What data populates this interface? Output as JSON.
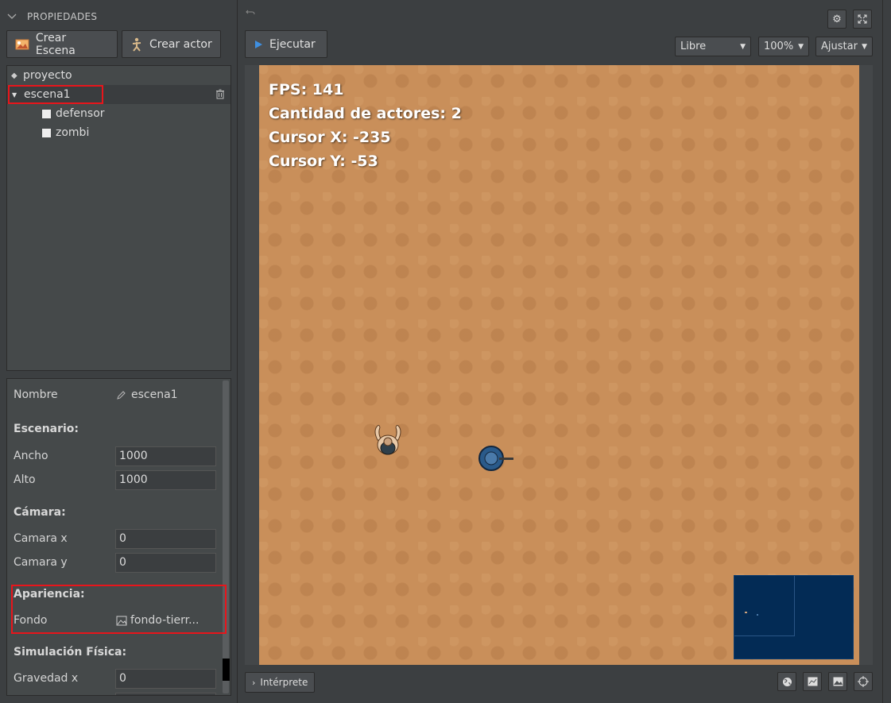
{
  "panel": {
    "title": "PROPIEDADES"
  },
  "toolbar": {
    "create_scene": "Crear Escena",
    "create_actor": "Crear actor"
  },
  "tree": {
    "items": [
      {
        "label": "proyecto"
      },
      {
        "label": "escena1"
      },
      {
        "label": "defensor"
      },
      {
        "label": "zombi"
      }
    ]
  },
  "properties": {
    "name_label": "Nombre",
    "name_value": "escena1",
    "scenario_title": "Escenario:",
    "width_label": "Ancho",
    "width_value": "1000",
    "height_label": "Alto",
    "height_value": "1000",
    "camera_title": "Cámara:",
    "camera_x_label": "Camara x",
    "camera_x_value": "0",
    "camera_y_label": "Camara y",
    "camera_y_value": "0",
    "appearance_title": "Apariencia:",
    "background_label": "Fondo",
    "background_value": "fondo-tierr...",
    "physics_title": "Simulación Física:",
    "gravity_x_label": "Gravedad x",
    "gravity_x_value": "0"
  },
  "editor": {
    "run_label": "Ejecutar",
    "mode_select": "Libre",
    "zoom_select": "100%",
    "fit_select": "Ajustar",
    "interpreter_label": "Intérprete"
  },
  "hud": {
    "fps": "FPS: 141",
    "actors": "Cantidad de actores: 2",
    "cursor_x": "Cursor X: -235",
    "cursor_y": "Cursor Y: -53"
  },
  "colors": {
    "highlight": "#e8151b",
    "canvas": "#c98f5a",
    "minimap": "#032b55",
    "play": "#3f8fe0"
  }
}
